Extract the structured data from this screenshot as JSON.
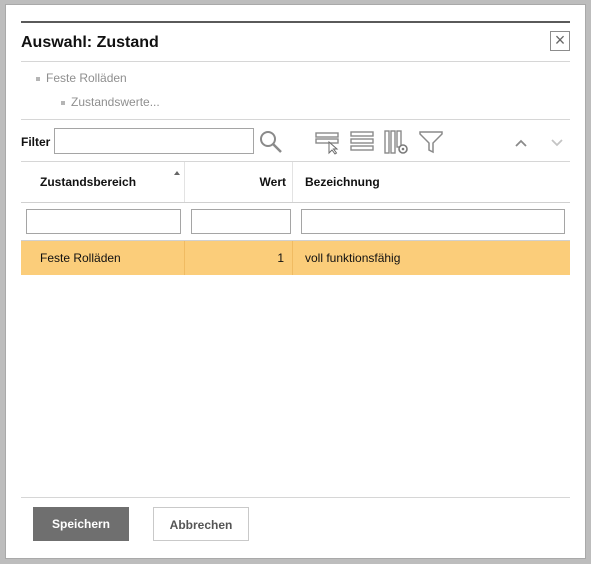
{
  "dialog": {
    "title": "Auswahl: Zustand",
    "close_label": "×"
  },
  "breadcrumb": {
    "items": [
      "Feste Rolläden",
      "Zustandswerte..."
    ]
  },
  "toolbar": {
    "filter_label": "Filter",
    "filter_value": "",
    "icons": [
      "search-icon",
      "select-row-icon",
      "rows-list-icon",
      "column-settings-icon",
      "funnel-filter-icon",
      "chevron-up-icon",
      "chevron-down-icon"
    ]
  },
  "grid": {
    "columns": [
      "Zustandsbereich",
      "Wert",
      "Bezeichnung"
    ],
    "sorted_column": "Zustandsbereich",
    "filters": [
      "",
      "",
      ""
    ],
    "rows": [
      {
        "zustandsbereich": "Feste Rolläden",
        "wert": "1",
        "bezeichnung": "voll funktionsfähig",
        "selected": true
      }
    ]
  },
  "footer": {
    "save_label": "Speichern",
    "cancel_label": "Abbrechen"
  },
  "colors": {
    "selected_row": "#fbcd7a",
    "primary_button": "#6f6f6f"
  }
}
